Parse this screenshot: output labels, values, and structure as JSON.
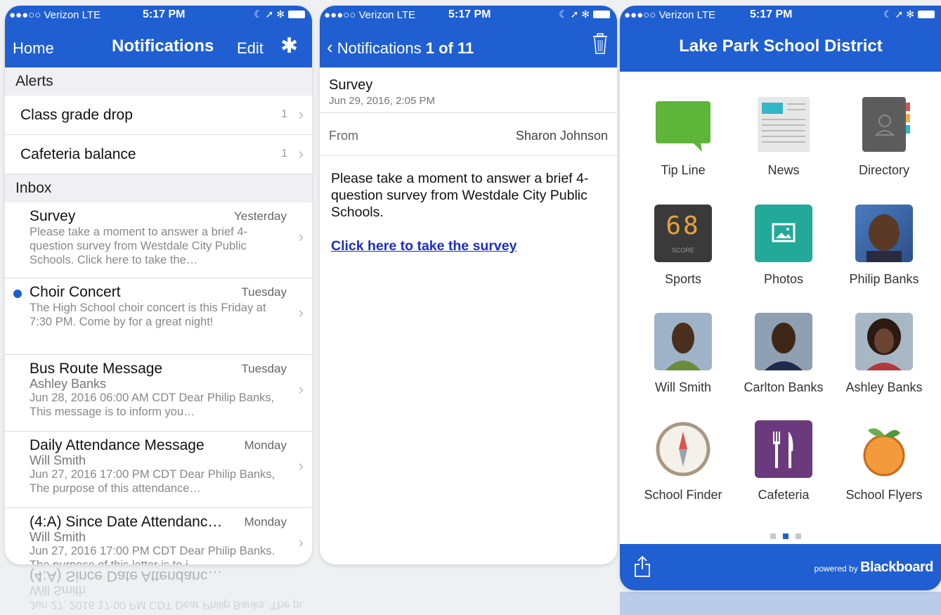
{
  "status": {
    "carrier": "●●●○○ Verizon  LTE",
    "time": "5:17 PM",
    "icons": "☾ ➚ ✻"
  },
  "screen1": {
    "nav": {
      "home": "Home",
      "title": "Notifications",
      "edit": "Edit"
    },
    "alerts_header": "Alerts",
    "alerts": [
      {
        "label": "Class grade drop",
        "count": "1"
      },
      {
        "label": "Cafeteria balance",
        "count": "1"
      }
    ],
    "inbox_header": "Inbox",
    "inbox": [
      {
        "subject": "Survey",
        "day": "Yesterday",
        "sender": "",
        "preview": "Please take a moment to answer a brief 4-question survey from Westdale City Public Schools.   Click here to take the…"
      },
      {
        "subject": "Choir Concert",
        "day": "Tuesday",
        "sender": "",
        "preview": "The High School choir concert is this Friday at 7:30 PM. Come by for a great night!"
      },
      {
        "subject": "Bus Route Message",
        "day": "Tuesday",
        "sender": "Ashley Banks",
        "preview": "Jun 28, 2016 06:00 AM CDT  Dear Philip Banks,  This message is to inform you…"
      },
      {
        "subject": "Daily Attendance Message",
        "day": "Monday",
        "sender": "Will Smith",
        "preview": "Jun 27, 2016 17:00 PM CDT Dear Philip Banks, The purpose of this attendance…"
      },
      {
        "subject": "(4:A) Since Date Attendanc…",
        "day": "Monday",
        "sender": "Will Smith",
        "preview": "Jun 27, 2016 17:00 PM CDT  Dear Philip Banks. The purpose of this letter is to i"
      }
    ]
  },
  "screen2": {
    "nav": {
      "back": "Notifications",
      "counter": "1 of 11"
    },
    "subject": "Survey",
    "date": "Jun 29, 2016, 2:05 PM",
    "from_label": "From",
    "from_value": "Sharon Johnson",
    "body": "Please take a moment to answer a brief 4-question survey from Westdale City Public Schools.",
    "link": "Click here to take the survey"
  },
  "screen3": {
    "title": "Lake Park School District",
    "tiles": [
      {
        "label": "Tip Line",
        "icon": "speech-bubble-icon"
      },
      {
        "label": "News",
        "icon": "newspaper-icon"
      },
      {
        "label": "Directory",
        "icon": "address-book-icon"
      },
      {
        "label": "Sports",
        "icon": "scoreboard-icon",
        "score": "68",
        "score_caption": "SCORE"
      },
      {
        "label": "Photos",
        "icon": "photo-icon"
      },
      {
        "label": "Philip Banks",
        "icon": "avatar"
      },
      {
        "label": "Will Smith",
        "icon": "avatar"
      },
      {
        "label": "Carlton Banks",
        "icon": "avatar"
      },
      {
        "label": "Ashley Banks",
        "icon": "avatar"
      },
      {
        "label": "School Finder",
        "icon": "compass-icon"
      },
      {
        "label": "Cafeteria",
        "icon": "fork-knife-icon"
      },
      {
        "label": "School Flyers",
        "icon": "peach-icon"
      }
    ],
    "pager": {
      "pages": 3,
      "active": 2
    },
    "footer": {
      "powered_by": "powered by",
      "brand": "Blackboard"
    }
  },
  "colors": {
    "brand_blue": "#1f5fd1",
    "link_blue": "#1a2ec7"
  }
}
